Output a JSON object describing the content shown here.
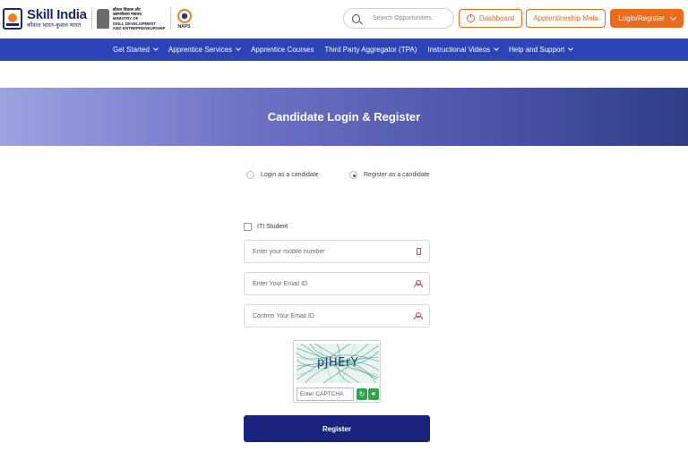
{
  "header": {
    "logo_title": "Skill India",
    "logo_subtitle": "कौशल भारत-कुशल भारत",
    "ministry_lines": [
      "कौशल विकास और",
      "उद्यमशीलता मंत्रालय",
      "MINISTRY OF",
      "SKILL DEVELOPMENT",
      "AND ENTREPRENEURSHIP"
    ],
    "naps_label": "NAPS",
    "search_placeholder": "Search Opportunities",
    "dashboard_label": "Dashboard",
    "mela_label": "Apprenticeship Mela",
    "login_label": "Login/Register"
  },
  "nav": {
    "items": [
      {
        "label": "Get Started",
        "dropdown": true
      },
      {
        "label": "Apprentice Services",
        "dropdown": true
      },
      {
        "label": "Apprentice Courses",
        "dropdown": false
      },
      {
        "label": "Third Party Aggregator (TPA)",
        "dropdown": false
      },
      {
        "label": "Instructional Videos",
        "dropdown": true
      },
      {
        "label": "Help and Support",
        "dropdown": true
      }
    ]
  },
  "banner": {
    "title": "Candidate Login & Register"
  },
  "mode": {
    "login_label": "Login as a candidate",
    "register_label": "Register as a candidate",
    "selected": "register"
  },
  "form": {
    "iti_label": "ITI Student",
    "mobile_placeholder": "Enter your mobile number",
    "email_placeholder": "Enter Your Email ID",
    "confirm_email_placeholder": "Confirm Your Email ID",
    "captcha_text": "pJHErY",
    "captcha_placeholder": "Enter CAPTCHA",
    "register_label": "Register"
  },
  "colors": {
    "accent_orange": "#ec6b1d",
    "nav_blue": "#2c44b8",
    "register_navy": "#1a237e",
    "captcha_green": "#2ea44f"
  }
}
